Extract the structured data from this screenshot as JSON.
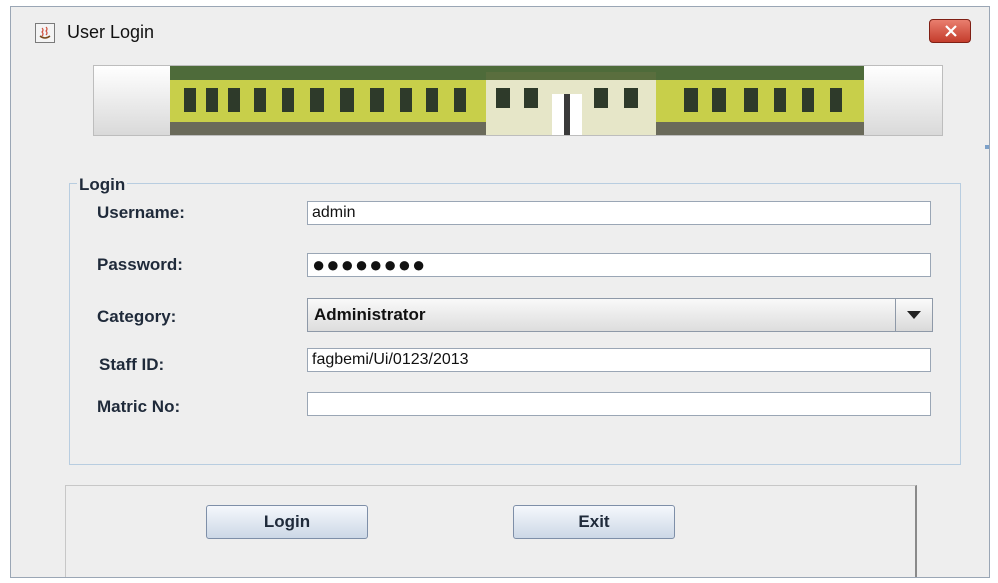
{
  "window": {
    "title": "User Login"
  },
  "banner": {
    "image": "building-photo"
  },
  "login_group": {
    "title": "Login"
  },
  "fields": {
    "username": {
      "label": "Username:",
      "value": "admin"
    },
    "password": {
      "label": "Password:",
      "value": "●●●●●●●●"
    },
    "category": {
      "label": "Category:",
      "selected": "Administrator"
    },
    "staff_id": {
      "label": "Staff ID:",
      "value": "fagbemi/Ui/0123/2013"
    },
    "matric_no": {
      "label": "Matric No:",
      "value": ""
    }
  },
  "buttons": {
    "login": "Login",
    "exit": "Exit"
  },
  "icons": {
    "app": "java-cup-icon",
    "close": "close-icon",
    "dropdown": "chevron-down-icon"
  },
  "colors": {
    "close_button": "#d0503c",
    "group_border": "#b8cde0",
    "building": "#c8cf4a",
    "roof": "#4e6b3a"
  }
}
